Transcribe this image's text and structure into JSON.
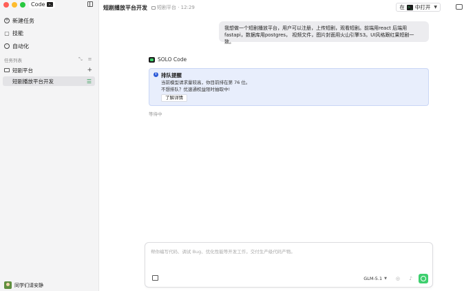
{
  "window": {
    "app_badge": "Code"
  },
  "sidebar": {
    "nav": [
      {
        "label": "新建任务",
        "icon": "plus-circle-icon"
      },
      {
        "label": "技能",
        "icon": "skill-box-icon"
      },
      {
        "label": "自动化",
        "icon": "clock-icon"
      }
    ],
    "section_label": "任务列表",
    "project": {
      "name": "短剧平台"
    },
    "task": {
      "name": "短剧播放平台开发"
    },
    "user": {
      "name": "同学们请安静"
    }
  },
  "header": {
    "title": "短剧播放平台开发",
    "breadcrumb": "短剧平台 · 12:29",
    "open_prefix": "在",
    "open_label": "中打开"
  },
  "conversation": {
    "user_message": "我想做一个短剧播放平台，用户可以注册，上传短剧，观看短剧。前端用react 后端用fastapi，数据库用postgres， 视频文件，图片封面用火山引擎S3。UI风格跟红果短剧一致。",
    "agent_name": "SOLO Code",
    "queue": {
      "title": "排队提醒",
      "line1": "当前模型请求量较高，你目前排在第 76 位。",
      "line2": "不想排队？优速通权益限时抽取中!",
      "button": "了解详情"
    },
    "waiting": "等待中"
  },
  "composer": {
    "placeholder": "帮你编写代码、调试 Bug、优化性能等开发工作，交付生产级代码产物。",
    "value": "",
    "model": "GLM-5.1"
  },
  "colors": {
    "accent_green": "#3ecf6e",
    "info_blue": "#2d5bd8",
    "card_bg": "#e8eefc"
  }
}
